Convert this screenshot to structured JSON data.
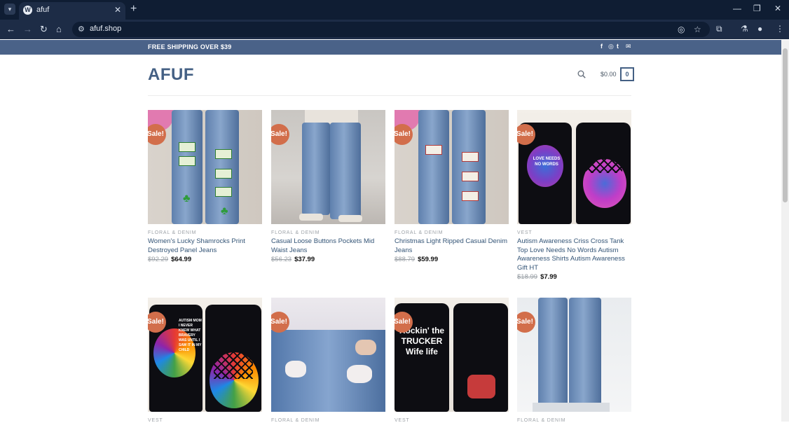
{
  "browser": {
    "tab_title": "afuf",
    "url": "afuf.shop",
    "new_tab": "+",
    "minimize": "—",
    "restore": "❐",
    "close": "✕"
  },
  "topbar": {
    "shipping": "FREE SHIPPING OVER $39"
  },
  "header": {
    "logo": "AFUF",
    "cart_total": "$0.00",
    "cart_count": "0"
  },
  "sale_label": "Sale!",
  "products": [
    {
      "category": "FLORAL & DENIM",
      "name": "Women's Lucky Shamrocks Print Destroyed Panel Jeans",
      "old_price": "$92.29",
      "price": "$64.99"
    },
    {
      "category": "FLORAL & DENIM",
      "name": "Casual Loose Buttons Pockets Mid Waist Jeans",
      "old_price": "$56.23",
      "price": "$37.99"
    },
    {
      "category": "FLORAL & DENIM",
      "name": "Christmas Light Ripped Casual Denim Jeans",
      "old_price": "$88.79",
      "price": "$59.99"
    },
    {
      "category": "VEST",
      "name": "Autism Awareness Criss Cross Tank Top Love Needs No Words Autism Awareness Shirts Autism Awareness Gift HT",
      "old_price": "$18.99",
      "price": "$7.99"
    },
    {
      "category": "VEST"
    },
    {
      "category": "FLORAL & DENIM"
    },
    {
      "category": "VEST"
    },
    {
      "category": "FLORAL & DENIM"
    }
  ],
  "image_text": {
    "love_needs": "LOVE NEEDS NO WORDS",
    "autism_mom": "AUTISM MOM I NEVER KNEW WHAT BRAVERY WAS UNTIL I SAW IT IN MY CHILD",
    "rockin": "Rockin' the TRUCKER Wife life"
  },
  "colors": {
    "topbar": "#4a6288",
    "brand": "#446084",
    "sale_badge": "#d26e4b",
    "link": "#335476"
  }
}
